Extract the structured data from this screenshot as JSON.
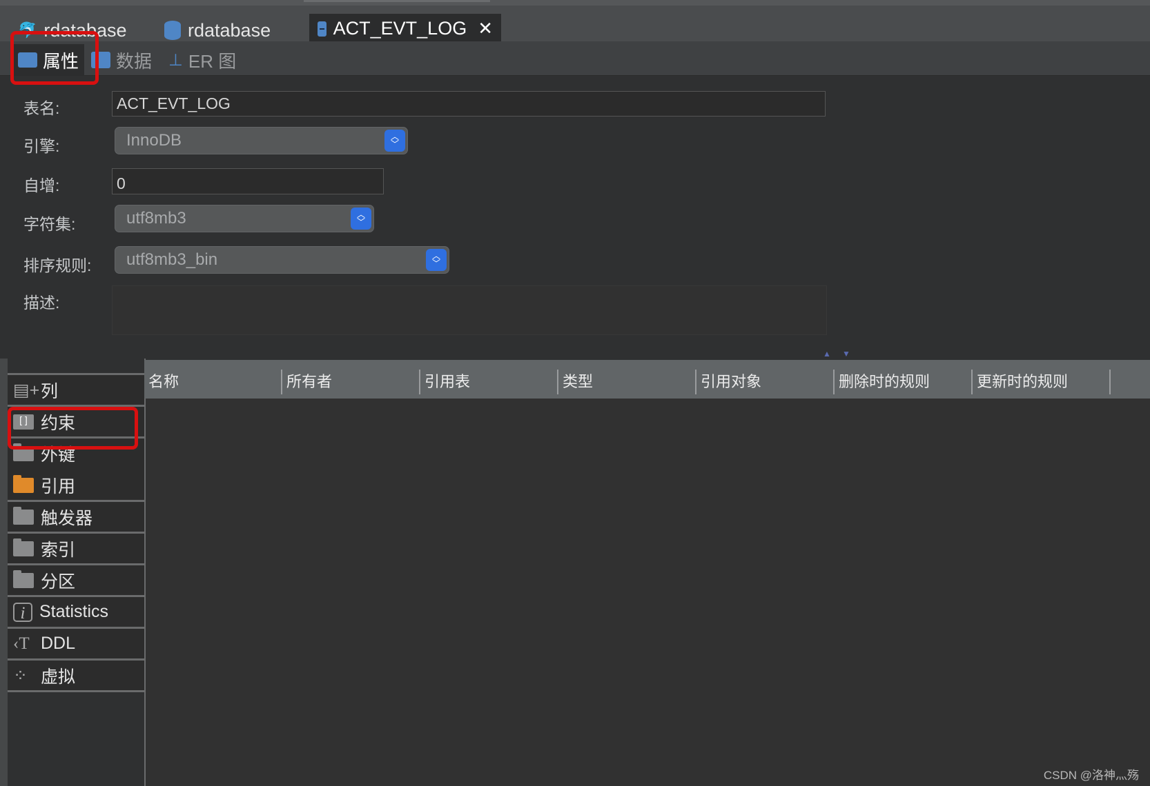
{
  "tabs": [
    {
      "label": "rdatabase",
      "icon": "mysql-icon"
    },
    {
      "label": "rdatabase",
      "icon": "database-icon"
    },
    {
      "label": "ACT_EVT_LOG",
      "icon": "table-icon",
      "active": true
    }
  ],
  "subtabs": [
    {
      "label": "属性",
      "active": true
    },
    {
      "label": "数据"
    },
    {
      "label": "ER 图"
    }
  ],
  "form": {
    "table_name_label": "表名:",
    "table_name": "ACT_EVT_LOG",
    "engine_label": "引擎:",
    "engine": "InnoDB",
    "auto_inc_label": "自增:",
    "auto_inc": "0",
    "charset_label": "字符集:",
    "charset": "utf8mb3",
    "collation_label": "排序规则:",
    "collation": "utf8mb3_bin",
    "desc_label": "描述:",
    "desc": ""
  },
  "sidebar": [
    {
      "label": "列"
    },
    {
      "label": "约束"
    },
    {
      "label": "外键"
    },
    {
      "label": "引用",
      "active": true
    },
    {
      "label": "触发器"
    },
    {
      "label": "索引"
    },
    {
      "label": "分区"
    },
    {
      "label": "Statistics"
    },
    {
      "label": "DDL"
    },
    {
      "label": "虚拟"
    }
  ],
  "table": {
    "columns": [
      "名称",
      "所有者",
      "引用表",
      "类型",
      "引用对象",
      "删除时的规则",
      "更新时的规则"
    ]
  },
  "watermark": "CSDN @洛神灬殇",
  "colors": {
    "accent": "#2f6fe0",
    "highlight": "#d81010",
    "active_folder": "#e08a2a"
  }
}
